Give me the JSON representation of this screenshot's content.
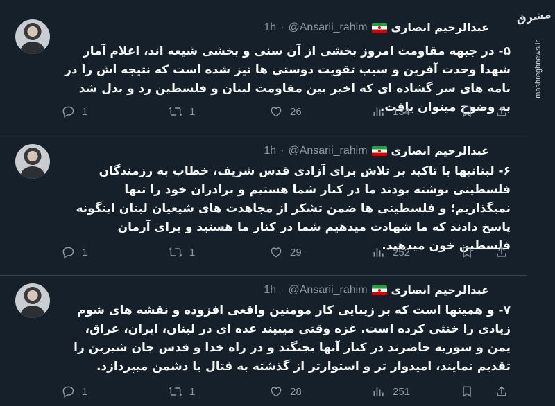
{
  "watermark": {
    "logo": "مشرق",
    "url": "mashreghnews.ir"
  },
  "tweets": [
    {
      "name": "عبدالرحیم انصاری",
      "handle": "@Ansarii_rahim",
      "dot": "·",
      "time": "1h",
      "text": "۵- در جبهه مقاومت امروز بخشی از آن سنی و بخشی شیعه اند، اعلام آمار شهدا وحدت آفرین و سبب تقویت دوستی ها نیز شده است که نتیجه اش را در نامه های سر گشاده ای که اخیر بین مقاومت لبنان و فلسطین رد و بدل شد به وضوح میتوان یافت.",
      "replies": "1",
      "retweets": "1",
      "likes": "26",
      "views": "134"
    },
    {
      "name": "عبدالرحیم انصاری",
      "handle": "@Ansarii_rahim",
      "dot": "·",
      "time": "1h",
      "text": "۶- لبنانیها با تاکید بر تلاش برای آزادی قدس شریف، خطاب به رزمندگان فلسطینی نوشته بودند ما در کنار شما هستیم و برادران خود را تنها نمیگذاریم؛ و فلسطینی ها ضمن تشکر از مجاهدت های شیعیان لبنان اینگونه پاسخ دادند که ما شهادت میدهیم شما در کنار ما هستید و برای آرمان فلسطین خون میدهید.",
      "replies": "1",
      "retweets": "1",
      "likes": "29",
      "views": "252"
    },
    {
      "name": "عبدالرحیم انصاری",
      "handle": "@Ansarii_rahim",
      "dot": "·",
      "time": "1h",
      "text": "۷- و همینها است که بر زیبایی کار مومنین واقعی افزوده و نقشه های شوم زیادی را خنثی کرده است. غزه وقتی میبیند عده ای در لبنان، ایران، عراق، یمن و سوریه حاضرند در کنار آنها بجنگند و در راه خدا و قدس جان شیرین را تقدیم نمایند، امیدوار تر و استوارتر از گذشته به قتال با دشمن میپردازد.",
      "replies": "1",
      "retweets": "1",
      "likes": "28",
      "views": "251"
    }
  ]
}
